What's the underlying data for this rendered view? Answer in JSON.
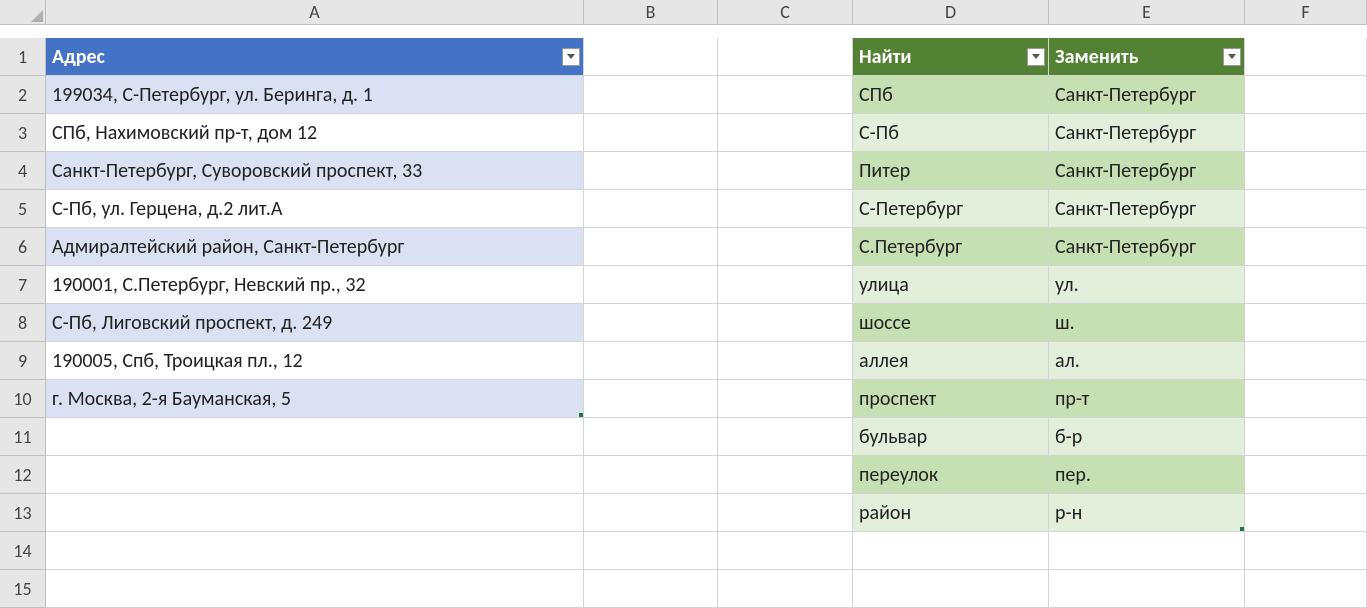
{
  "columns": [
    "A",
    "B",
    "C",
    "D",
    "E",
    "F"
  ],
  "rowCount": 15,
  "tableA": {
    "header": "Адрес",
    "rows": [
      "199034, С-Петербург, ул. Беринга, д. 1",
      "СПб, Нахимовский пр-т, дом 12",
      "Санкт-Петербург, Суворовский проспект, 33",
      "С-Пб, ул. Герцена, д.2 лит.А",
      "Адмиралтейский район, Санкт-Петербург",
      "190001, С.Петербург, Невский пр., 32",
      "С-Пб, Лиговский проспект, д. 249",
      "190005, Спб, Троицкая пл., 12",
      "г. Москва, 2-я Бауманская, 5"
    ]
  },
  "tableDE": {
    "headerD": "Найти",
    "headerE": "Заменить",
    "rows": [
      {
        "d": "СПб",
        "e": "Санкт-Петербург"
      },
      {
        "d": "С-Пб",
        "e": "Санкт-Петербург"
      },
      {
        "d": "Питер",
        "e": "Санкт-Петербург"
      },
      {
        "d": "С-Петербург",
        "e": "Санкт-Петербург"
      },
      {
        "d": "С.Петербург",
        "e": "Санкт-Петербург"
      },
      {
        "d": "улица",
        "e": "ул."
      },
      {
        "d": "шоссе",
        "e": "ш."
      },
      {
        "d": "аллея",
        "e": "ал."
      },
      {
        "d": "проспект",
        "e": "пр-т"
      },
      {
        "d": "бульвар",
        "e": "б-р"
      },
      {
        "d": "переулок",
        "e": "пер."
      },
      {
        "d": "район",
        "e": "р-н"
      }
    ]
  }
}
